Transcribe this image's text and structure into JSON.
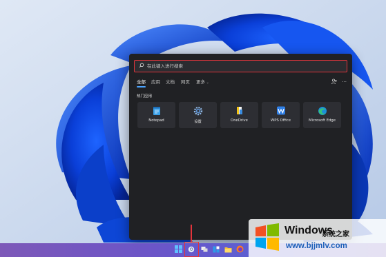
{
  "search": {
    "placeholder": "在此键入进行搜索"
  },
  "tabs": [
    {
      "label": "全部",
      "active": true
    },
    {
      "label": "应用",
      "active": false
    },
    {
      "label": "文档",
      "active": false
    },
    {
      "label": "网页",
      "active": false
    },
    {
      "label": "更多",
      "active": false
    }
  ],
  "right_icons": [
    "people-share-icon",
    "more-options-icon"
  ],
  "section": {
    "title": "热门应用"
  },
  "apps": [
    {
      "label": "Notepad",
      "icon": "notepad-icon"
    },
    {
      "label": "设置",
      "icon": "settings-gear-icon"
    },
    {
      "label": "OneDrive",
      "icon": "onedrive-icon"
    },
    {
      "label": "WPS Office",
      "icon": "wps-office-icon"
    },
    {
      "label": "Microsoft Edge",
      "icon": "edge-icon"
    }
  ],
  "taskbar": {
    "icons": [
      "start-icon",
      "search-icon",
      "task-view-icon",
      "widgets-icon",
      "file-explorer-icon",
      "firefox-icon"
    ]
  },
  "watermark": {
    "title": "Windows",
    "subtitle": "系统之家",
    "url": "www.bjjmlv.com"
  },
  "colors": {
    "highlight": "#e3343b",
    "panel_bg": "#202124",
    "tile_bg": "#2d2e33",
    "accent": "#4aa3ff",
    "url": "#1c5fb8"
  }
}
